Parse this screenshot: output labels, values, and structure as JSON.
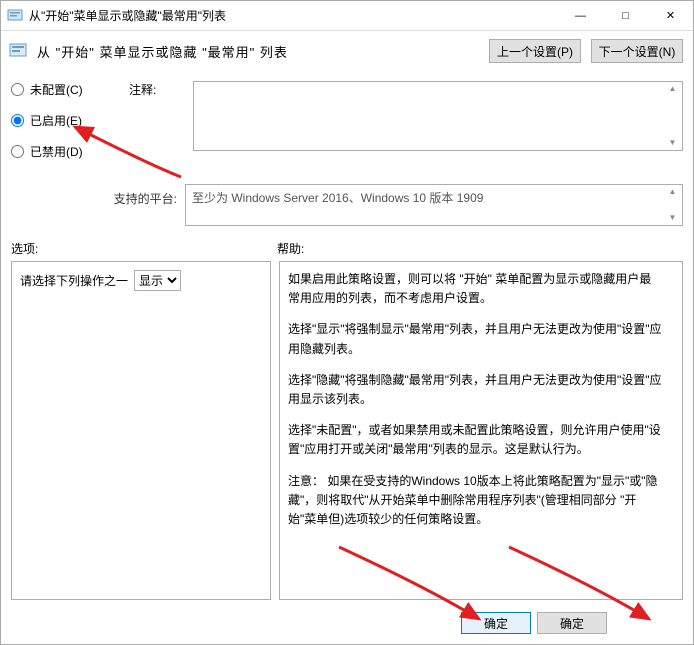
{
  "window": {
    "title": "从\"开始\"菜单显示或隐藏\"最常用\"列表",
    "subtitle": "从 \"开始\" 菜单显示或隐藏 \"最常用\" 列表"
  },
  "nav": {
    "prev": "上一个设置(P)",
    "next": "下一个设置(N)"
  },
  "radios": {
    "not_configured": "未配置(C)",
    "enabled": "已启用(E)",
    "disabled": "已禁用(D)",
    "selected": "enabled"
  },
  "labels": {
    "notes": "注释:",
    "supported_on": "支持的平台:",
    "options": "选项:",
    "help": "帮助:"
  },
  "platform": {
    "text": "至少为 Windows Server 2016、Windows 10 版本 1909"
  },
  "options": {
    "prompt": "请选择下列操作之一",
    "dropdown_value": "显示"
  },
  "help": {
    "p1": "如果启用此策略设置，则可以将 \"开始\" 菜单配置为显示或隐藏用户最常用应用的列表，而不考虑用户设置。",
    "p2": "选择\"显示\"将强制显示\"最常用\"列表，并且用户无法更改为使用\"设置\"应用隐藏列表。",
    "p3": "选择\"隐藏\"将强制隐藏\"最常用\"列表，并且用户无法更改为使用\"设置\"应用显示该列表。",
    "p4": "选择\"未配置\"，或者如果禁用或未配置此策略设置，则允许用户使用\"设置\"应用打开或关闭\"最常用\"列表的显示。这是默认行为。",
    "p5": "注意：  如果在受支持的Windows 10版本上将此策略配置为\"显示\"或\"隐藏\"，则将取代\"从开始菜单中删除常用程序列表\"(管理相同部分 \"开始\"菜单但)选项较少的任何策略设置。"
  },
  "buttons": {
    "ok": "确定",
    "ok2": "确定"
  },
  "window_controls": {
    "minimize": "—",
    "maximize": "□",
    "close": "✕"
  }
}
